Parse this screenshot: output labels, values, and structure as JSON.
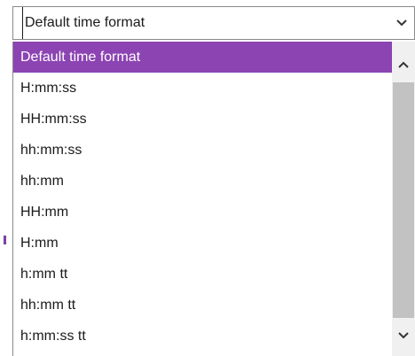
{
  "combo": {
    "value": "Default time format"
  },
  "dropdown": {
    "options": [
      "Default time format",
      "H:mm:ss",
      "HH:mm:ss",
      "hh:mm:ss",
      "hh:mm",
      "HH:mm",
      "H:mm",
      "h:mm tt",
      "hh:mm tt",
      "h:mm:ss tt"
    ],
    "selected_index": 0
  },
  "icons": {
    "combo_arrow": "chevron-down-icon",
    "scroll_up": "chevron-up-icon",
    "scroll_down": "chevron-down-icon"
  },
  "colors": {
    "selection": "#8c44b3",
    "scroll_thumb": "#c2c2c2",
    "scroll_track": "#f0f0f0"
  }
}
